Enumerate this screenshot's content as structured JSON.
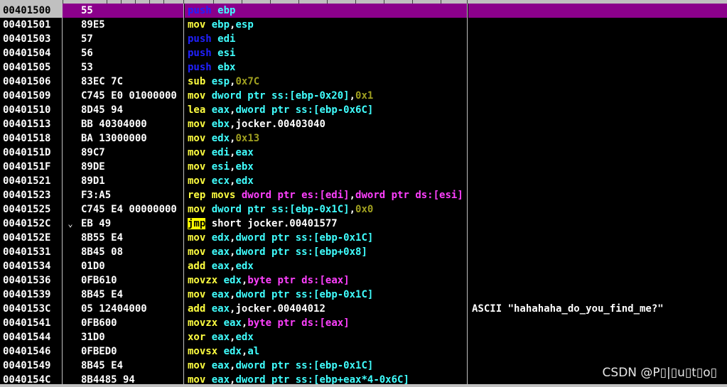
{
  "colors": {
    "background": "#000000",
    "selection": "#8b008b",
    "address": "#ffffff",
    "mnemonic": "#ffff40",
    "push": "#2020ff",
    "register": "#40ffff",
    "immediate": "#a0a020",
    "memory": "#ff40ff",
    "jump_highlight": "#ffff00"
  },
  "disassembly": {
    "rows": [
      {
        "addr": "00401500",
        "mark": "",
        "hex": "55",
        "mn": "push",
        "mnClass": "mn-push",
        "ops": [
          {
            "t": "ebp",
            "c": "op-reg"
          }
        ],
        "comment": "",
        "selected": true
      },
      {
        "addr": "00401501",
        "mark": "",
        "hex": "89E5",
        "mn": "mov",
        "mnClass": "mn",
        "ops": [
          {
            "t": "ebp",
            "c": "op-reg"
          },
          {
            "t": ",",
            "c": "op-plain"
          },
          {
            "t": "esp",
            "c": "op-reg"
          }
        ],
        "comment": ""
      },
      {
        "addr": "00401503",
        "mark": "",
        "hex": "57",
        "mn": "push",
        "mnClass": "mn-push",
        "ops": [
          {
            "t": "edi",
            "c": "op-reg"
          }
        ],
        "comment": ""
      },
      {
        "addr": "00401504",
        "mark": "",
        "hex": "56",
        "mn": "push",
        "mnClass": "mn-push",
        "ops": [
          {
            "t": "esi",
            "c": "op-reg"
          }
        ],
        "comment": ""
      },
      {
        "addr": "00401505",
        "mark": "",
        "hex": "53",
        "mn": "push",
        "mnClass": "mn-push",
        "ops": [
          {
            "t": "ebx",
            "c": "op-reg"
          }
        ],
        "comment": ""
      },
      {
        "addr": "00401506",
        "mark": "",
        "hex": "83EC 7C",
        "mn": "sub",
        "mnClass": "mn",
        "ops": [
          {
            "t": "esp",
            "c": "op-reg"
          },
          {
            "t": ",",
            "c": "op-plain"
          },
          {
            "t": "0x7C",
            "c": "op-num"
          }
        ],
        "comment": ""
      },
      {
        "addr": "00401509",
        "mark": "",
        "hex": "C745 E0 01000000",
        "mn": "mov",
        "mnClass": "mn",
        "ops": [
          {
            "t": "dword ptr ss:[ebp-0x20]",
            "c": "op-reg"
          },
          {
            "t": ",",
            "c": "op-plain"
          },
          {
            "t": "0x1",
            "c": "op-num"
          }
        ],
        "comment": ""
      },
      {
        "addr": "00401510",
        "mark": "",
        "hex": "8D45 94",
        "mn": "lea",
        "mnClass": "mn",
        "ops": [
          {
            "t": "eax",
            "c": "op-reg"
          },
          {
            "t": ",",
            "c": "op-plain"
          },
          {
            "t": "dword ptr ss:[ebp-0x6C]",
            "c": "op-reg"
          }
        ],
        "comment": ""
      },
      {
        "addr": "00401513",
        "mark": "",
        "hex": "BB 40304000",
        "mn": "mov",
        "mnClass": "mn",
        "ops": [
          {
            "t": "ebx",
            "c": "op-reg"
          },
          {
            "t": ",",
            "c": "op-plain"
          },
          {
            "t": "jocker.00403040",
            "c": "op-plain"
          }
        ],
        "comment": ""
      },
      {
        "addr": "00401518",
        "mark": "",
        "hex": "BA 13000000",
        "mn": "mov",
        "mnClass": "mn",
        "ops": [
          {
            "t": "edx",
            "c": "op-reg"
          },
          {
            "t": ",",
            "c": "op-plain"
          },
          {
            "t": "0x13",
            "c": "op-num"
          }
        ],
        "comment": ""
      },
      {
        "addr": "0040151D",
        "mark": "",
        "hex": "89C7",
        "mn": "mov",
        "mnClass": "mn",
        "ops": [
          {
            "t": "edi",
            "c": "op-reg"
          },
          {
            "t": ",",
            "c": "op-plain"
          },
          {
            "t": "eax",
            "c": "op-reg"
          }
        ],
        "comment": ""
      },
      {
        "addr": "0040151F",
        "mark": "",
        "hex": "89DE",
        "mn": "mov",
        "mnClass": "mn",
        "ops": [
          {
            "t": "esi",
            "c": "op-reg"
          },
          {
            "t": ",",
            "c": "op-plain"
          },
          {
            "t": "ebx",
            "c": "op-reg"
          }
        ],
        "comment": ""
      },
      {
        "addr": "00401521",
        "mark": "",
        "hex": "89D1",
        "mn": "mov",
        "mnClass": "mn",
        "ops": [
          {
            "t": "ecx",
            "c": "op-reg"
          },
          {
            "t": ",",
            "c": "op-plain"
          },
          {
            "t": "edx",
            "c": "op-reg"
          }
        ],
        "comment": ""
      },
      {
        "addr": "00401523",
        "mark": "",
        "hex": "F3:A5",
        "mn": "rep movs",
        "mnClass": "mn",
        "ops": [
          {
            "t": "dword ptr es:[edi]",
            "c": "op-mem"
          },
          {
            "t": ",",
            "c": "op-plain"
          },
          {
            "t": "dword ptr ds:[esi]",
            "c": "op-mem"
          }
        ],
        "comment": ""
      },
      {
        "addr": "00401525",
        "mark": "",
        "hex": "C745 E4 00000000",
        "mn": "mov",
        "mnClass": "mn",
        "ops": [
          {
            "t": "dword ptr ss:[ebp-0x1C]",
            "c": "op-reg"
          },
          {
            "t": ",",
            "c": "op-plain"
          },
          {
            "t": "0x0",
            "c": "op-num"
          }
        ],
        "comment": ""
      },
      {
        "addr": "0040152C",
        "mark": "⌄",
        "hex": "EB 49",
        "mn": "jmp",
        "mnClass": "mn-jmp",
        "ops": [
          {
            "t": "short jocker.00401577",
            "c": "op-plain"
          }
        ],
        "comment": ""
      },
      {
        "addr": "0040152E",
        "mark": "",
        "hex": "8B55 E4",
        "mn": "mov",
        "mnClass": "mn",
        "ops": [
          {
            "t": "edx",
            "c": "op-reg"
          },
          {
            "t": ",",
            "c": "op-plain"
          },
          {
            "t": "dword ptr ss:[ebp-0x1C]",
            "c": "op-reg"
          }
        ],
        "comment": ""
      },
      {
        "addr": "00401531",
        "mark": "",
        "hex": "8B45 08",
        "mn": "mov",
        "mnClass": "mn",
        "ops": [
          {
            "t": "eax",
            "c": "op-reg"
          },
          {
            "t": ",",
            "c": "op-plain"
          },
          {
            "t": "dword ptr ss:[ebp+0x8]",
            "c": "op-reg"
          }
        ],
        "comment": ""
      },
      {
        "addr": "00401534",
        "mark": "",
        "hex": "01D0",
        "mn": "add",
        "mnClass": "mn",
        "ops": [
          {
            "t": "eax",
            "c": "op-reg"
          },
          {
            "t": ",",
            "c": "op-plain"
          },
          {
            "t": "edx",
            "c": "op-reg"
          }
        ],
        "comment": ""
      },
      {
        "addr": "00401536",
        "mark": "",
        "hex": "0FB610",
        "mn": "movzx",
        "mnClass": "mn",
        "ops": [
          {
            "t": "edx",
            "c": "op-reg"
          },
          {
            "t": ",",
            "c": "op-plain"
          },
          {
            "t": "byte ptr ds:[eax]",
            "c": "op-mem"
          }
        ],
        "comment": ""
      },
      {
        "addr": "00401539",
        "mark": "",
        "hex": "8B45 E4",
        "mn": "mov",
        "mnClass": "mn",
        "ops": [
          {
            "t": "eax",
            "c": "op-reg"
          },
          {
            "t": ",",
            "c": "op-plain"
          },
          {
            "t": "dword ptr ss:[ebp-0x1C]",
            "c": "op-reg"
          }
        ],
        "comment": ""
      },
      {
        "addr": "0040153C",
        "mark": "",
        "hex": "05 12404000",
        "mn": "add",
        "mnClass": "mn",
        "ops": [
          {
            "t": "eax",
            "c": "op-reg"
          },
          {
            "t": ",",
            "c": "op-plain"
          },
          {
            "t": "jocker.00404012",
            "c": "op-plain"
          }
        ],
        "comment": "ASCII \"hahahaha_do_you_find_me?\""
      },
      {
        "addr": "00401541",
        "mark": "",
        "hex": "0FB600",
        "mn": "movzx",
        "mnClass": "mn",
        "ops": [
          {
            "t": "eax",
            "c": "op-reg"
          },
          {
            "t": ",",
            "c": "op-plain"
          },
          {
            "t": "byte ptr ds:[eax]",
            "c": "op-mem"
          }
        ],
        "comment": ""
      },
      {
        "addr": "00401544",
        "mark": "",
        "hex": "31D0",
        "mn": "xor",
        "mnClass": "mn",
        "ops": [
          {
            "t": "eax",
            "c": "op-reg"
          },
          {
            "t": ",",
            "c": "op-plain"
          },
          {
            "t": "edx",
            "c": "op-reg"
          }
        ],
        "comment": ""
      },
      {
        "addr": "00401546",
        "mark": "",
        "hex": "0FBED0",
        "mn": "movsx",
        "mnClass": "mn",
        "ops": [
          {
            "t": "edx",
            "c": "op-reg"
          },
          {
            "t": ",",
            "c": "op-plain"
          },
          {
            "t": "al",
            "c": "op-reg"
          }
        ],
        "comment": ""
      },
      {
        "addr": "00401549",
        "mark": "",
        "hex": "8B45 E4",
        "mn": "mov",
        "mnClass": "mn",
        "ops": [
          {
            "t": "eax",
            "c": "op-reg"
          },
          {
            "t": ",",
            "c": "op-plain"
          },
          {
            "t": "dword ptr ss:[ebp-0x1C]",
            "c": "op-reg"
          }
        ],
        "comment": ""
      },
      {
        "addr": "0040154C",
        "mark": "",
        "hex": "8B4485 94",
        "mn": "mov",
        "mnClass": "mn",
        "ops": [
          {
            "t": "eax",
            "c": "op-reg"
          },
          {
            "t": ",",
            "c": "op-plain"
          },
          {
            "t": "dword ptr ss:[ebp+eax*4-0x6C]",
            "c": "op-reg"
          }
        ],
        "comment": ""
      }
    ]
  },
  "watermark": "CSDN @P▯|▯u▯t▯o▯"
}
